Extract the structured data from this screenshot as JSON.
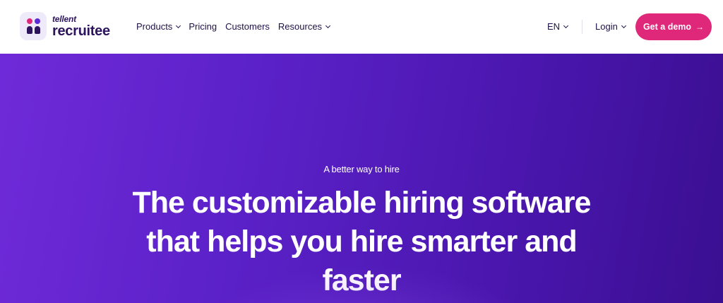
{
  "brand": {
    "top": "tellent",
    "bottom": "recruitee"
  },
  "nav": {
    "items": [
      {
        "label": "Products",
        "has_dropdown": true
      },
      {
        "label": "Pricing",
        "has_dropdown": false
      },
      {
        "label": "Customers",
        "has_dropdown": false
      },
      {
        "label": "Resources",
        "has_dropdown": true
      }
    ],
    "language": "EN",
    "login": "Login",
    "cta": "Get a demo",
    "cta_arrow": "→"
  },
  "hero": {
    "eyebrow": "A better way to hire",
    "headline": "The customizable hiring software that helps you hire smarter and faster"
  },
  "colors": {
    "accent": "#e0287a",
    "brand_dark": "#2d145e",
    "hero_gradient_start": "#6f2ad8",
    "hero_gradient_end": "#3a0f91"
  }
}
